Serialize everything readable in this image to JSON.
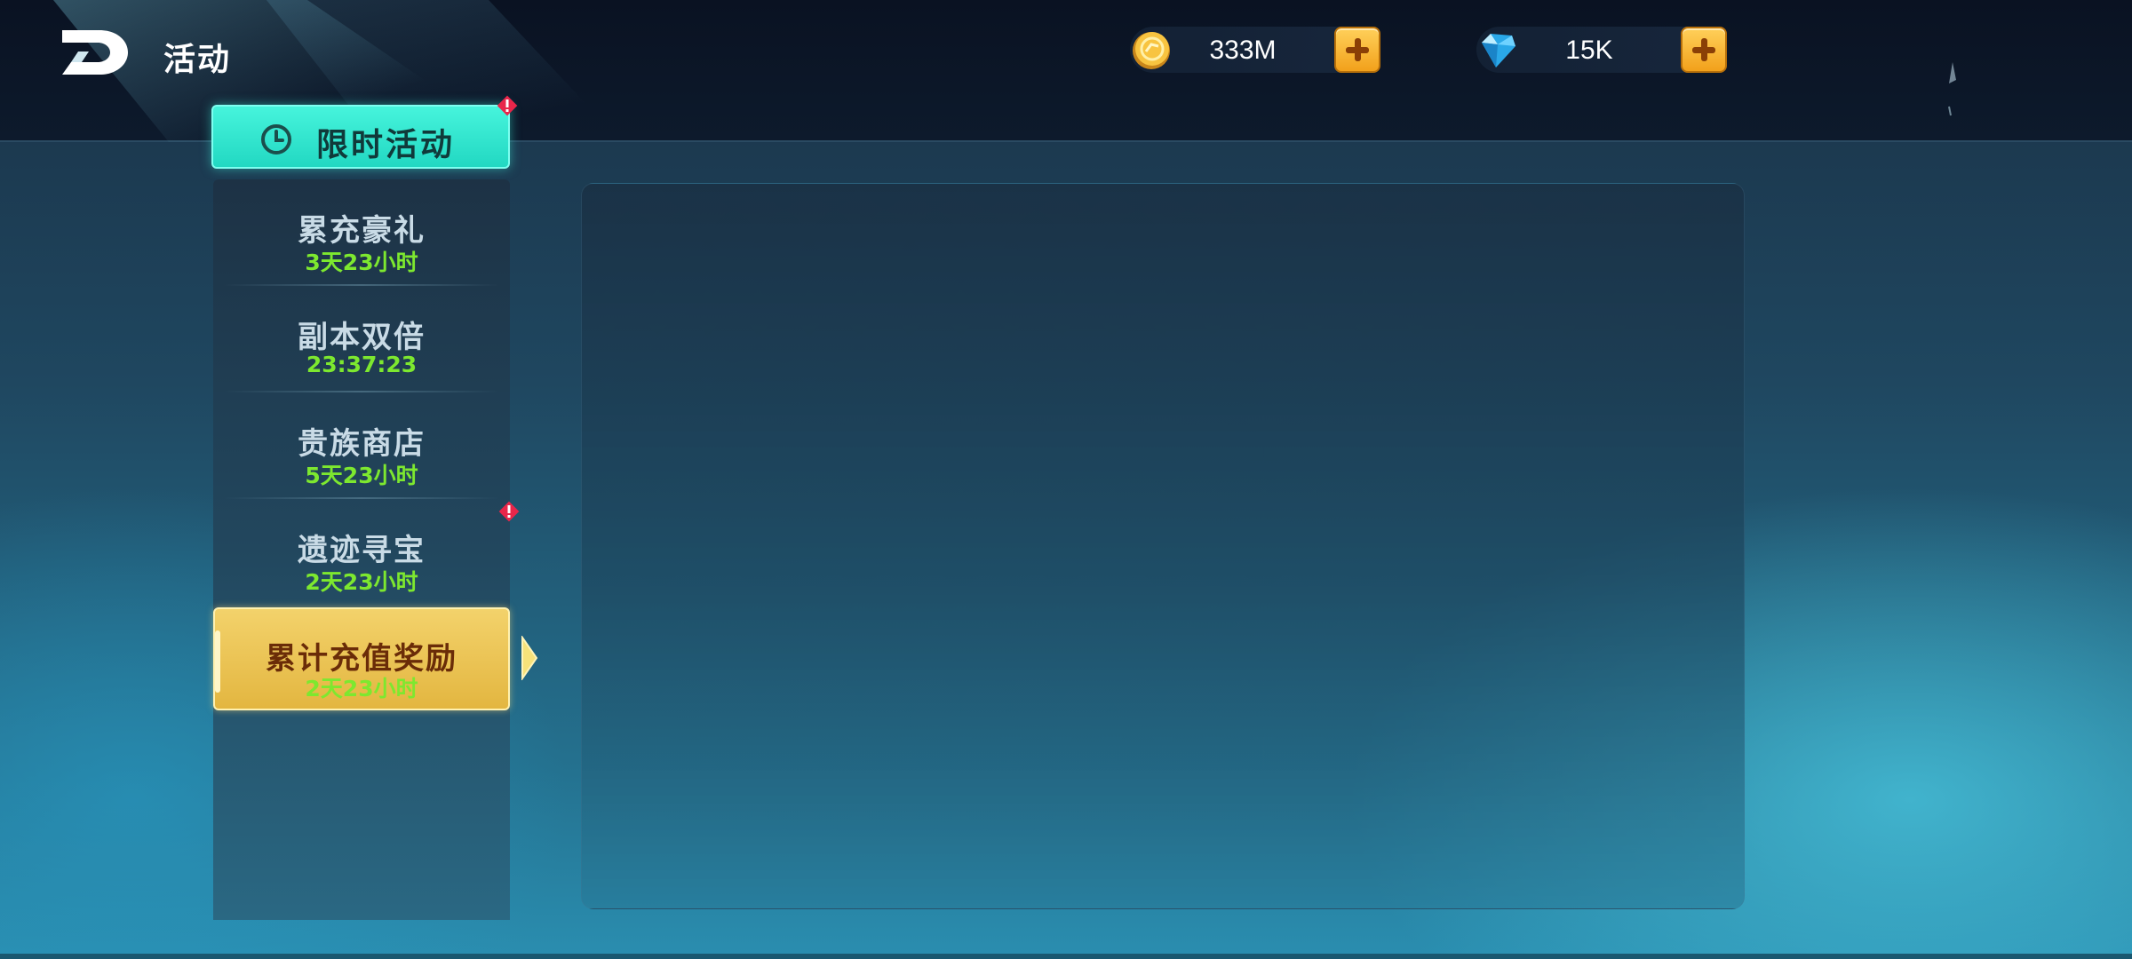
{
  "header": {
    "title": "活动"
  },
  "currencies": [
    {
      "name": "gold",
      "value": "333M"
    },
    {
      "name": "diamond",
      "value": "15K"
    }
  ],
  "category": {
    "label": "限时活动"
  },
  "activities": [
    {
      "name": "累充豪礼",
      "time": "3天23小时",
      "active": false
    },
    {
      "name": "副本双倍",
      "time": "23:37:23",
      "active": false
    },
    {
      "name": "贵族商店",
      "time": "5天23小时",
      "active": false
    },
    {
      "name": "遗迹寻宝",
      "time": "2天23小时",
      "active": false
    },
    {
      "name": "累计充值奖励",
      "time": "2天23小时",
      "active": true
    }
  ],
  "colors": {
    "accent_cyan": "#2ae0c8",
    "active_gold": "#e9c24f",
    "timer_green": "#7de82f"
  }
}
